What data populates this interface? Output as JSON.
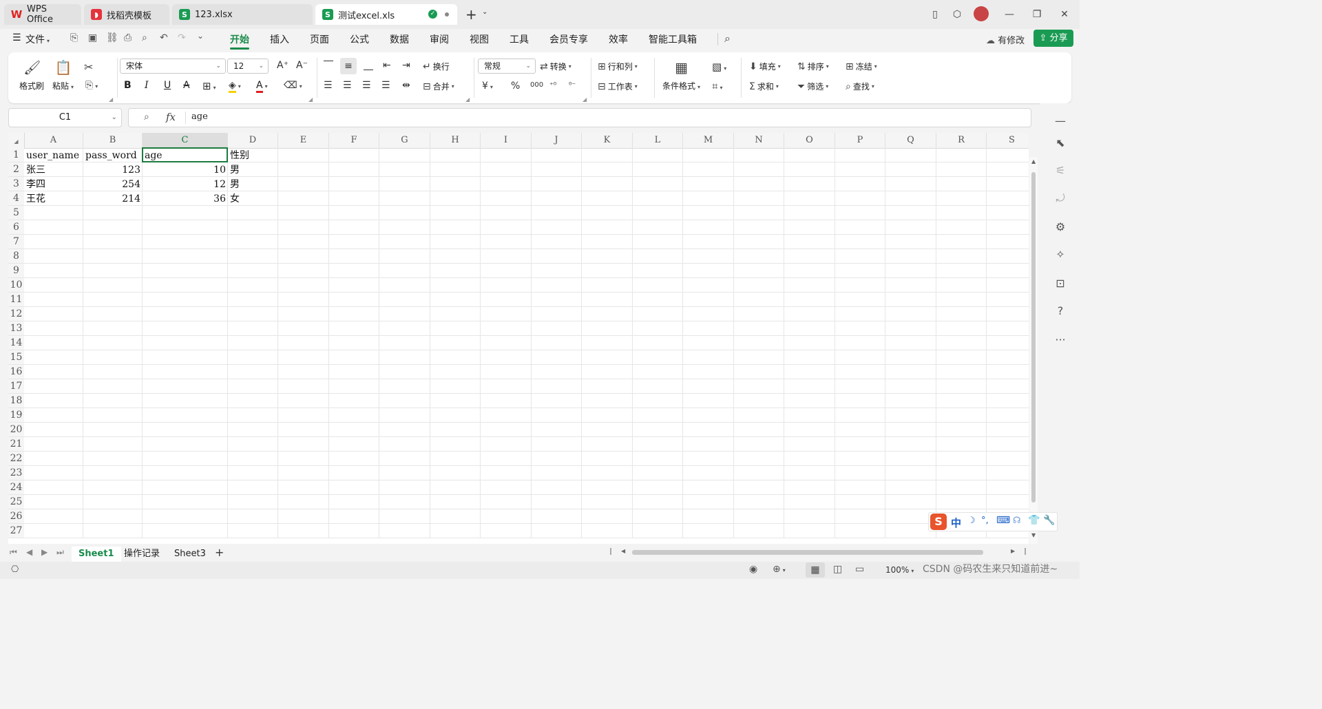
{
  "titlebar": {
    "tabs": [
      {
        "label": "WPS Office",
        "icon": "wps-logo-icon",
        "active": false
      },
      {
        "label": "找稻壳模板",
        "icon": "docer-icon",
        "active": false
      },
      {
        "label": "123.xlsx",
        "icon": "spreadsheet-icon",
        "active": false
      },
      {
        "label": "测试excel.xls",
        "icon": "spreadsheet-icon",
        "active": true
      }
    ],
    "new_tab_label": "+"
  },
  "menubar": {
    "file_label": "文件",
    "items": [
      "开始",
      "插入",
      "页面",
      "公式",
      "数据",
      "审阅",
      "视图",
      "工具",
      "会员专享",
      "效率",
      "智能工具箱"
    ],
    "active_item": "开始",
    "modify_label": "有修改",
    "share_label": "分享"
  },
  "ribbon": {
    "format_painter": "格式刷",
    "paste": "粘贴",
    "font_name": "宋体",
    "font_size": "12",
    "wrap": "换行",
    "merge": "合并",
    "number_format": "常规",
    "convert": "转换",
    "row_col": "行和列",
    "worksheet": "工作表",
    "cond_format": "条件格式",
    "fill": "填充",
    "sort": "排序",
    "freeze": "冻结",
    "sum": "求和",
    "filter": "筛选",
    "find": "查找",
    "bold": "B",
    "italic": "I",
    "underline": "U",
    "strike": "A",
    "currency": "¥",
    "percent": "%",
    "thousands": "000"
  },
  "formula_bar": {
    "name_box": "C1",
    "fx": "fx",
    "content": "age"
  },
  "sheet": {
    "columns": [
      "A",
      "B",
      "C",
      "D",
      "E",
      "F",
      "G",
      "H",
      "I",
      "J",
      "K",
      "L",
      "M",
      "N",
      "O",
      "P",
      "Q",
      "R",
      "S"
    ],
    "selected_column": "C",
    "rows": [
      "1",
      "2",
      "3",
      "4",
      "5",
      "6",
      "7",
      "8",
      "9",
      "10",
      "11",
      "12",
      "13",
      "14",
      "15",
      "16",
      "17",
      "18",
      "19",
      "20",
      "21",
      "22",
      "23",
      "24",
      "25",
      "26",
      "27"
    ],
    "data": [
      [
        "user_name",
        "pass_word",
        "age",
        "性别"
      ],
      [
        "张三",
        "123",
        "10",
        "男"
      ],
      [
        "李四",
        "254",
        "12",
        "男"
      ],
      [
        "王花",
        "214",
        "36",
        "女"
      ]
    ]
  },
  "sheet_tabs": {
    "tabs": [
      "Sheet1",
      "操作记录",
      "Sheet3"
    ],
    "active": "Sheet1",
    "add_label": "+"
  },
  "statusbar": {
    "zoom": "100%",
    "watermark": "CSDN @码农生来只知道前进~"
  },
  "ime": {
    "label": "中"
  },
  "colors": {
    "accent": "#1a8b4b",
    "selection": "#1a7a3e",
    "share_bg": "#1a9b53"
  }
}
